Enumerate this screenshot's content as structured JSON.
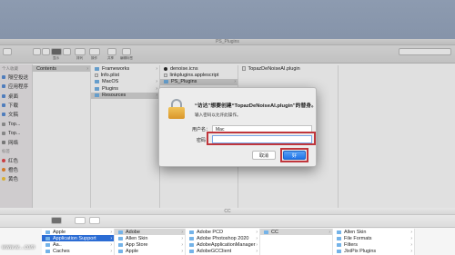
{
  "top_window": {
    "title": "PS_Plugins",
    "toolbar_labels": [
      "显示",
      "排列",
      "操作",
      "共享",
      "编辑标签"
    ],
    "sidebar": {
      "section_favorites": "个人收藏",
      "items": [
        "隔空投送",
        "应用程序",
        "桌面",
        "下载",
        "文稿",
        "Top...",
        "Top...",
        "网络"
      ],
      "section_tags": "标签",
      "tags": [
        {
          "label": "红色",
          "color": "#e5484d"
        },
        {
          "label": "橙色",
          "color": "#f08a2c"
        },
        {
          "label": "黄色",
          "color": "#f5c73b"
        }
      ]
    },
    "col1": {
      "items": [
        "Contents"
      ]
    },
    "col2": {
      "items": [
        "Frameworks",
        "Info.plist",
        "MacOS",
        "Plugins",
        "Resources"
      ]
    },
    "col3": {
      "items": [
        "denoise.icns",
        "linkplugins.applescript",
        "PS_Plugins"
      ]
    },
    "col4": {
      "items": [
        "TopazDeNoiseAI.plugin"
      ]
    }
  },
  "bottom_window": {
    "title": "CC",
    "col1": {
      "items": [
        "Apple",
        "Application Support",
        "Aa..",
        "Caches"
      ]
    },
    "col2": {
      "items": [
        "Adobe",
        "Allen Skin",
        "App Store",
        "Apple"
      ]
    },
    "col3": {
      "items": [
        "Adobe PCD",
        "Adobe Photoshop 2020",
        "AdobeApplicationManager",
        "AdobeGCClient"
      ]
    },
    "col4": {
      "items": [
        "CC"
      ]
    },
    "col5": {
      "items": [
        "Allen Skin",
        "File Formats",
        "Filters",
        "JixiPix Plugins"
      ]
    }
  },
  "dialog": {
    "title": "“访达”想要创建“TopazDeNoiseAI.plugin”的替身。",
    "subtitle": "输入密码以允许此操作。",
    "username_label": "用户名：",
    "username_value": "Mac",
    "password_label": "密码：",
    "password_value": "",
    "cancel_label": "取消",
    "ok_label": "好",
    "highlight_color": "#c0363c"
  },
  "watermark": "www.w....com"
}
